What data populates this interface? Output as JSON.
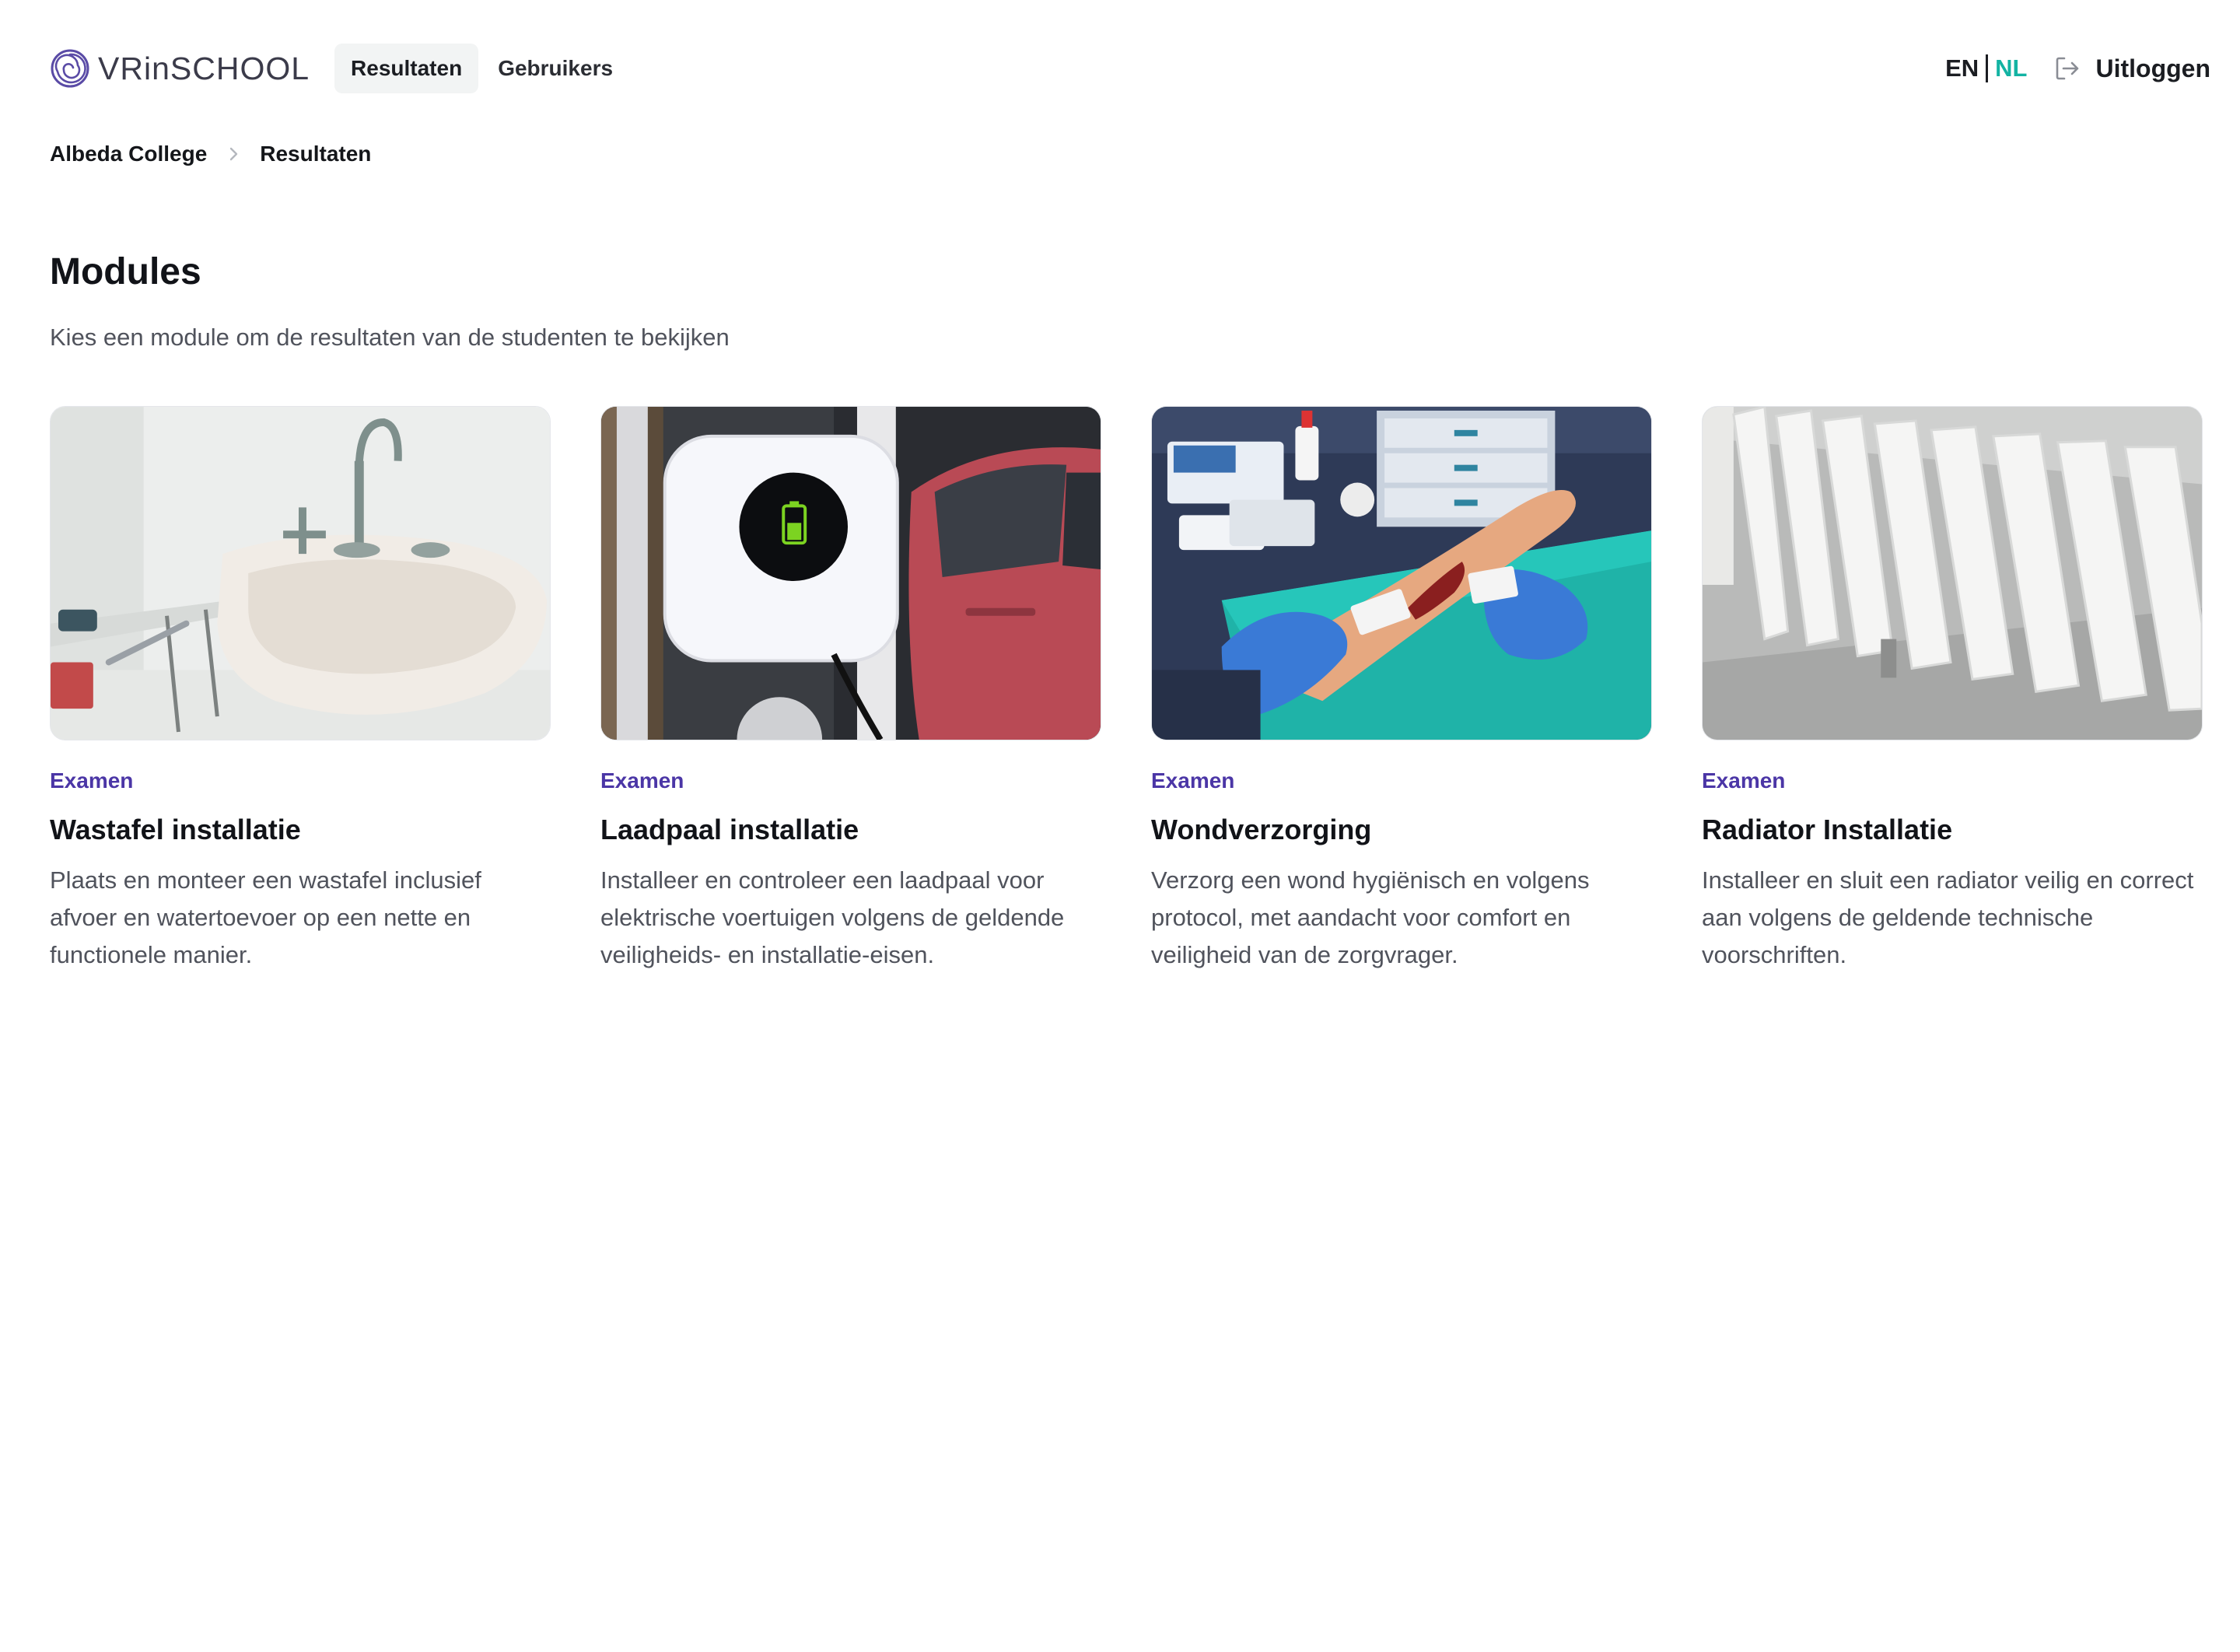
{
  "header": {
    "logo_text_prefix": "VRin",
    "logo_text_suffix": "SCHOOL",
    "nav": [
      {
        "label": "Resultaten",
        "active": true
      },
      {
        "label": "Gebruikers",
        "active": false
      }
    ],
    "lang_en": "EN",
    "lang_nl": "NL",
    "logout_label": "Uitloggen"
  },
  "breadcrumb": {
    "items": [
      "Albeda College",
      "Resultaten"
    ]
  },
  "section": {
    "title": "Modules",
    "subtitle": "Kies een module om de resultaten van de studenten te bekijken"
  },
  "modules": [
    {
      "tag": "Examen",
      "title": "Wastafel installatie",
      "description": "Plaats en monteer een wastafel inclusief afvoer en watertoevoer op een nette en functionele manier."
    },
    {
      "tag": "Examen",
      "title": "Laadpaal installatie",
      "description": "Installeer en controleer een laadpaal voor elektrische voertuigen volgens de geldende veiligheids- en installatie-eisen."
    },
    {
      "tag": "Examen",
      "title": "Wondverzorging",
      "description": "Verzorg een wond hygiënisch en volgens protocol, met aandacht voor comfort en veiligheid van de zorgvrager."
    },
    {
      "tag": "Examen",
      "title": "Radiator Installatie",
      "description": "Installeer en sluit een radiator veilig en correct aan volgens de geldende technische voorschriften."
    }
  ],
  "colors": {
    "accent_tag": "#4b36a6",
    "lang_active": "#13b3a3",
    "nav_active_bg": "#f2f4f4"
  },
  "icons": {
    "logo": "spiral-logo-icon",
    "logout": "logout-arrow-icon",
    "breadcrumb_separator": "chevron-right-icon",
    "charging_status": "battery-charging-icon"
  }
}
